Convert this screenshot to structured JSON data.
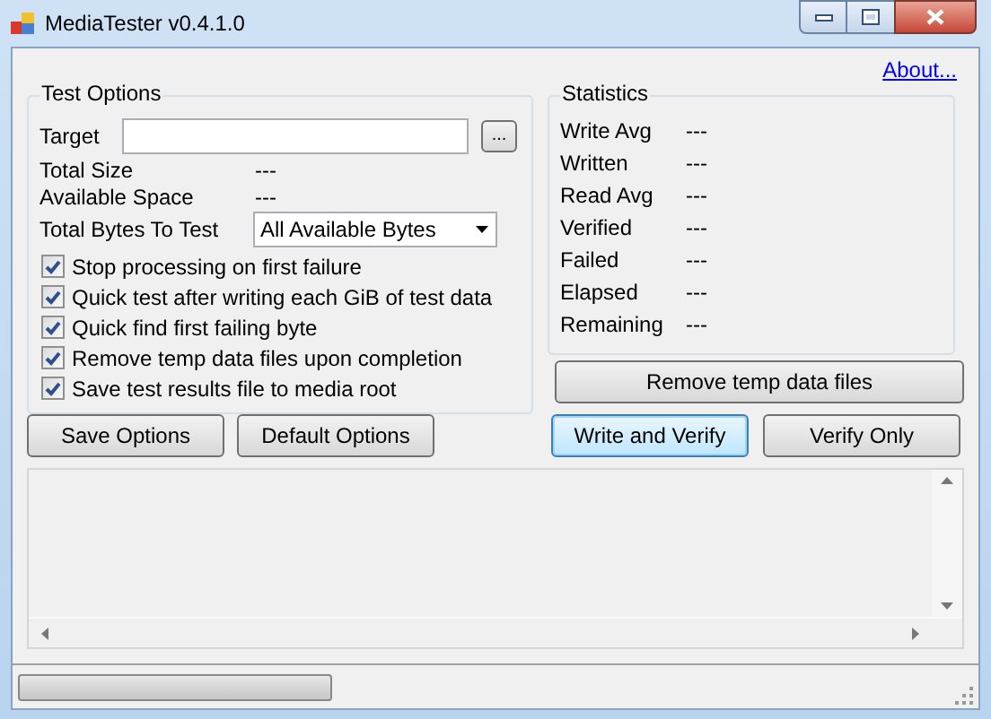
{
  "window": {
    "title": "MediaTester v0.4.1.0"
  },
  "about_link": "About...",
  "test_options": {
    "title": "Test Options",
    "target": {
      "label": "Target",
      "browse": "..."
    },
    "total_size": {
      "label": "Total Size",
      "value": "---"
    },
    "available_space": {
      "label": "Available Space",
      "value": "---"
    },
    "total_bytes": {
      "label": "Total Bytes To Test",
      "value": "All Available Bytes"
    },
    "options": [
      {
        "label": "Stop processing on first failure",
        "checked": true
      },
      {
        "label": "Quick test after writing each GiB of test data",
        "checked": true
      },
      {
        "label": "Quick find first failing byte",
        "checked": true
      },
      {
        "label": "Remove temp data files upon completion",
        "checked": true
      },
      {
        "label": "Save test results file to media root",
        "checked": true
      }
    ]
  },
  "statistics": {
    "title": "Statistics",
    "rows": [
      {
        "label": "Write Avg",
        "value": "---"
      },
      {
        "label": "Written",
        "value": "---"
      },
      {
        "label": "Read Avg",
        "value": "---"
      },
      {
        "label": "Verified",
        "value": "---"
      },
      {
        "label": "Failed",
        "value": "---"
      },
      {
        "label": "Elapsed",
        "value": "---"
      },
      {
        "label": "Remaining",
        "value": "---"
      }
    ]
  },
  "remove_button": "Remove temp data files",
  "left_buttons": [
    {
      "label": "Save Options",
      "focused": false
    },
    {
      "label": "Default Options",
      "focused": false
    }
  ],
  "right_buttons": [
    {
      "label": "Write and Verify",
      "focused": true
    },
    {
      "label": "Verify Only",
      "focused": false
    }
  ],
  "status_bar": {
    "progress": {
      "level": 0
    }
  }
}
